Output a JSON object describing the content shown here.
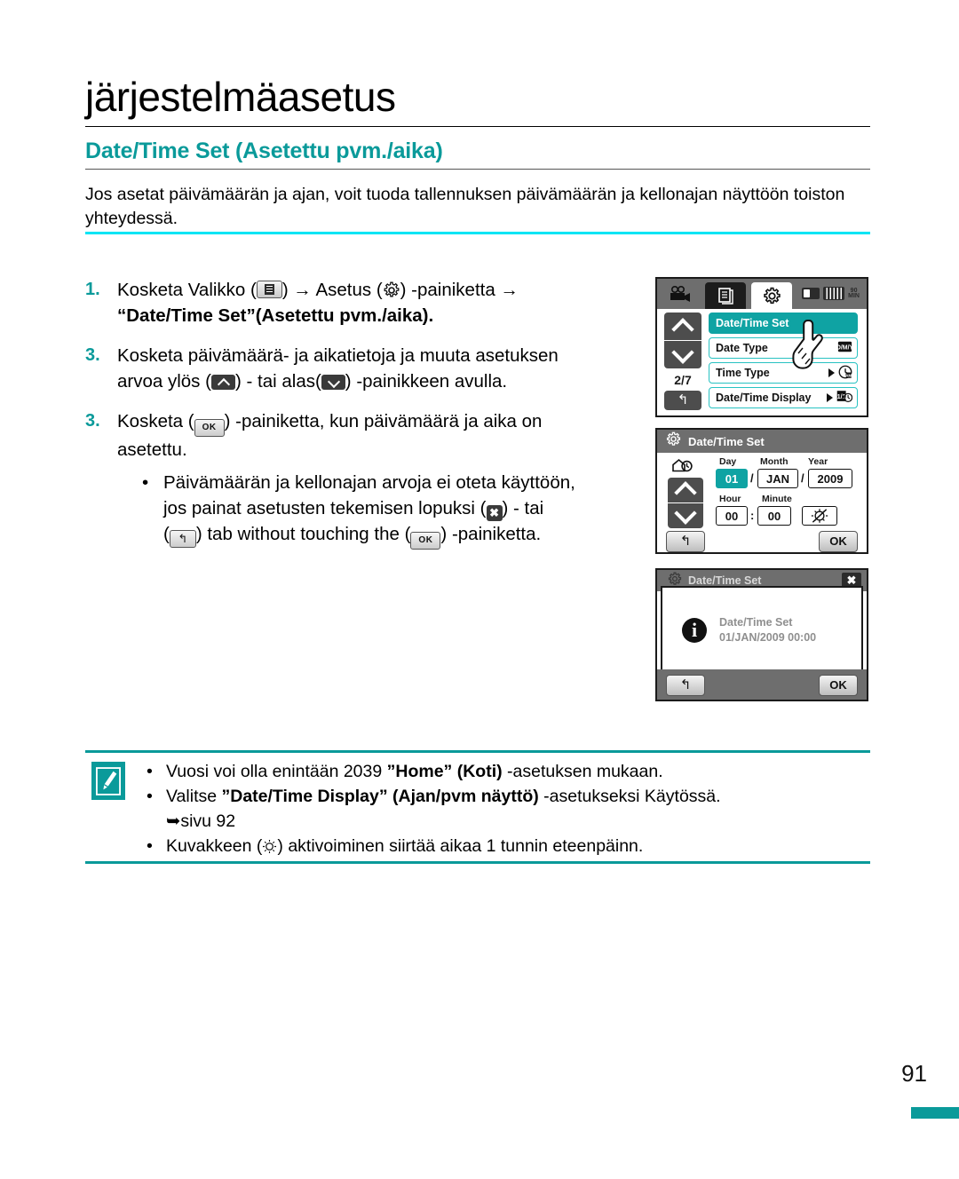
{
  "header": {
    "title": "järjestelmäasetus",
    "section_title": "Date/Time Set (Asetettu pvm./aika)"
  },
  "intro": "Jos asetat päivämäärän ja ajan, voit tuoda tallennuksen päivämäärän ja kellonajan näyttöön toiston yhteydessä.",
  "steps": [
    {
      "number": "1.",
      "text_before_menu": "Kosketa Valikko (",
      "text_between_icons": ") → Asetus (",
      "text_after_gear": ") -painiketta →",
      "bold_line": "“Date/Time Set”(Asetettu pvm./aika)."
    },
    {
      "number": "3.",
      "line1": "Kosketa päivämäärä- ja aikatietoja ja muuta asetuksen",
      "line2_a": "arvoa ylös (",
      "line2_b": ") - tai alas(",
      "line2_c": ") -painikkeen avulla."
    },
    {
      "number": "3.",
      "line1_a": "Kosketa (",
      "line1_b": ") -painiketta, kun päivämäärä ja aika on",
      "line2": "asetettu.",
      "bullets": [
        {
          "dot": "•",
          "line1": "Päivämäärän ja kellonajan arvoja ei oteta käyttöön,",
          "line2_a": "jos painat asetusten tekemisen lopuksi (",
          "line2_b": ") - tai",
          "line3_a": "(",
          "line3_b": ") tab without touching the (",
          "line3_c": ") -painiketta."
        }
      ]
    }
  ],
  "screen1": {
    "icons": {
      "camcorder": "camcorder-icon",
      "tab_document": "document-tab-icon",
      "tab_gear": "settings-tab-icon",
      "card": "memory-card-icon",
      "battery": "battery-icon"
    },
    "battery_minutes": "90",
    "battery_unit": "MIN",
    "page_indicator": "2/7",
    "back_label": "↰",
    "rows": [
      {
        "label": "Date/Time Set",
        "active": true,
        "right_icon": ""
      },
      {
        "label": "Date Type",
        "active": false,
        "right_icon": "date-type-icon"
      },
      {
        "label": "Time Type",
        "active": false,
        "right_icon": "clock-icon"
      },
      {
        "label": "Date/Time Display",
        "active": false,
        "right_icon": "date-time-display-icon"
      }
    ]
  },
  "screen2": {
    "title": "Date/Time Set",
    "labels": {
      "day": "Day",
      "month": "Month",
      "year": "Year",
      "hour": "Hour",
      "minute": "Minute"
    },
    "values": {
      "day": "01",
      "month": "JAN",
      "year": "2009",
      "hour": "00",
      "minute": "00"
    },
    "separator_date": "/",
    "separator_time": ":",
    "dst_icon": "daylight-saving-icon",
    "back_label": "↰",
    "ok_label": "OK"
  },
  "screen3": {
    "title": "Date/Time Set",
    "close_label": "✖",
    "message_line1": "Date/Time Set",
    "message_line2": "01/JAN/2009 00:00",
    "back_label": "↰",
    "ok_label": "OK"
  },
  "notes": [
    {
      "dot": "•",
      "a": "Vuosi voi olla enintään 2039 ",
      "bold": "”Home” (Koti)",
      "b": " -asetuksen mukaan."
    },
    {
      "dot": "•",
      "a": "Valitse ",
      "bold": "”Date/Time Display” (Ajan/pvm näyttö)",
      "b": " -asetukseksi Käytössä.",
      "reference": "➥sivu 92"
    },
    {
      "dot": "•",
      "a": "Kuvakkeen (",
      "b": ") aktivoiminen siirtää aikaa 1 tunnin eteenpäinn."
    }
  ],
  "footer": {
    "page_number": "91"
  },
  "colors": {
    "teal": "#0a9a9a",
    "cyan_rule": "#00e5f5",
    "screen_gray": "#6e6e6e",
    "highlight": "#0fa3a3"
  }
}
